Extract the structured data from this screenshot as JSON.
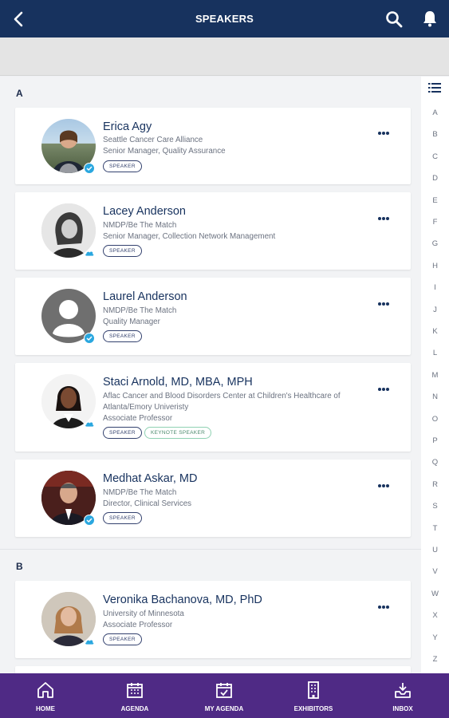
{
  "header": {
    "title": "SPEAKERS"
  },
  "sections": {
    "a": {
      "letter": "A"
    },
    "b": {
      "letter": "B"
    }
  },
  "speakers": [
    {
      "name": "Erica Agy",
      "org": "Seattle Cancer Care Alliance",
      "title": "Senior Manager, Quality Assurance",
      "tags": [
        "SPEAKER"
      ]
    },
    {
      "name": "Lacey Anderson",
      "org": "NMDP/Be The Match",
      "title": "Senior Manager, Collection Network Management",
      "tags": [
        "SPEAKER"
      ]
    },
    {
      "name": "Laurel Anderson",
      "org": "NMDP/Be The Match",
      "title": "Quality Manager",
      "tags": [
        "SPEAKER"
      ]
    },
    {
      "name": "Staci Arnold, MD, MBA, MPH",
      "org_line1": "Aflac Cancer and Blood Disorders Center at Children's Healthcare of",
      "org_line2": "Atlanta/Emory Univeristy",
      "title": "Associate Professor",
      "tags": [
        "SPEAKER",
        "KEYNOTE SPEAKER"
      ]
    },
    {
      "name": "Medhat Askar, MD",
      "org": "NMDP/Be The Match",
      "title": "Director, Clinical Services",
      "tags": [
        "SPEAKER"
      ]
    },
    {
      "name": "Veronika Bachanova, MD, PhD",
      "org": "University of Minnesota",
      "title": "Associate Professor",
      "tags": [
        "SPEAKER"
      ]
    }
  ],
  "alphabet": [
    "A",
    "B",
    "C",
    "D",
    "E",
    "F",
    "G",
    "H",
    "I",
    "J",
    "K",
    "L",
    "M",
    "N",
    "O",
    "P",
    "Q",
    "R",
    "S",
    "T",
    "U",
    "V",
    "W",
    "X",
    "Y",
    "Z"
  ],
  "nav": [
    {
      "label": "HOME",
      "icon": "home-icon"
    },
    {
      "label": "AGENDA",
      "icon": "calendar-icon"
    },
    {
      "label": "MY AGENDA",
      "icon": "calendar-check-icon"
    },
    {
      "label": "EXHIBITORS",
      "icon": "building-icon"
    },
    {
      "label": "INBOX",
      "icon": "inbox-icon"
    }
  ],
  "colors": {
    "header": "#17325e",
    "nav": "#4f2a85",
    "badge": "#2aa7df"
  }
}
